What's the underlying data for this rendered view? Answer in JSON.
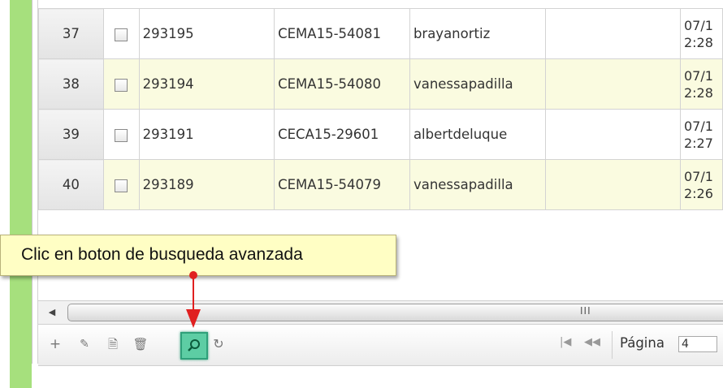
{
  "rows": [
    {
      "num": "37",
      "id": "293195",
      "code": "CEMA15-54081",
      "user": "brayanortiz",
      "empty": "",
      "date1": "07/1",
      "date2": "2:28"
    },
    {
      "num": "38",
      "id": "293194",
      "code": "CEMA15-54080",
      "user": "vanessapadilla",
      "empty": "",
      "date1": "07/1",
      "date2": "2:28"
    },
    {
      "num": "39",
      "id": "293191",
      "code": "CECA15-29601",
      "user": "albertdeluque",
      "empty": "",
      "date1": "07/1",
      "date2": "2:27"
    },
    {
      "num": "40",
      "id": "293189",
      "code": "CEMA15-54079",
      "user": "vanessapadilla",
      "empty": "",
      "date1": "07/1",
      "date2": "2:26"
    }
  ],
  "callout": {
    "text": "Clic en boton de busqueda avanzada"
  },
  "scrollbar": {
    "grip": "III"
  },
  "pager": {
    "page_label": "Página",
    "page_value": "4",
    "buttons": [
      "add-icon",
      "edit-icon",
      "view-icon",
      "delete-icon",
      "search-icon",
      "refresh-icon"
    ],
    "nav": [
      "first-page-icon",
      "prev-page-icon"
    ]
  },
  "colors": {
    "accent_green": "#a6e07d",
    "row_alt": "#fafbe0",
    "callout_bg": "#fffec4",
    "search_btn": "#5dcda4",
    "arrow": "#e02020"
  }
}
